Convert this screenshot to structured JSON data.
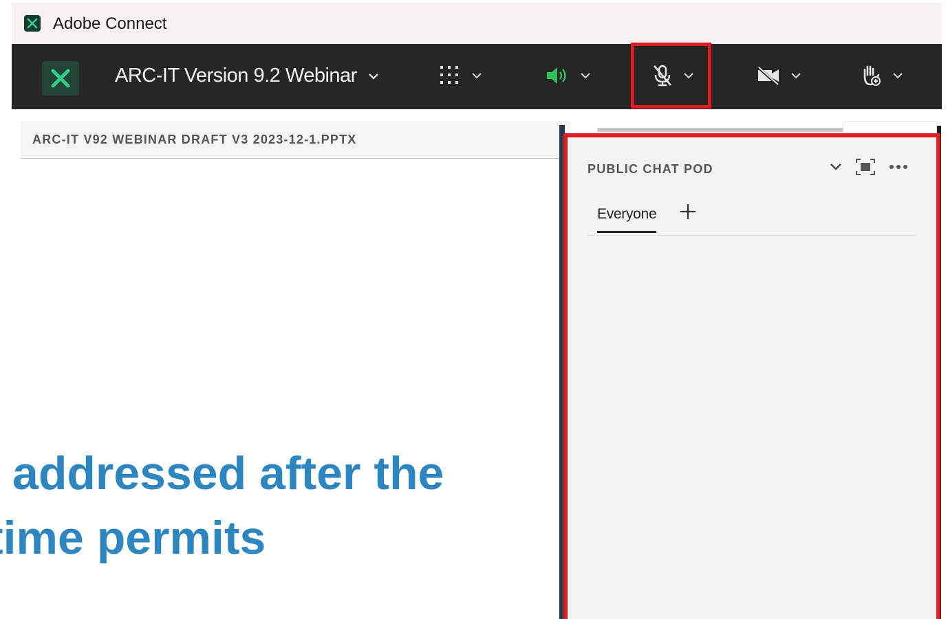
{
  "window": {
    "app_title": "Adobe Connect"
  },
  "toolbar": {
    "meeting_title": "ARC-IT Version 9.2 Webinar",
    "buttons": [
      {
        "name": "apps",
        "icon": "grid-icon"
      },
      {
        "name": "speaker",
        "icon": "speaker-icon",
        "color": "#2fbf5c"
      },
      {
        "name": "microphone",
        "icon": "mic-muted-icon",
        "highlighted": true
      },
      {
        "name": "camera",
        "icon": "camera-off-icon"
      },
      {
        "name": "raise-hand",
        "icon": "raise-hand-icon"
      }
    ]
  },
  "share_pod": {
    "title": "ARC-IT V92 WEBINAR DRAFT V3 2023-12-1.PPTX"
  },
  "slide": {
    "line1": "addressed after the",
    "line2": "time permits",
    "color": "#2e86c1"
  },
  "chat_pod": {
    "title": "PUBLIC CHAT POD",
    "tabs": [
      {
        "label": "Everyone",
        "active": true
      }
    ],
    "highlight_color": "#e31b23"
  }
}
